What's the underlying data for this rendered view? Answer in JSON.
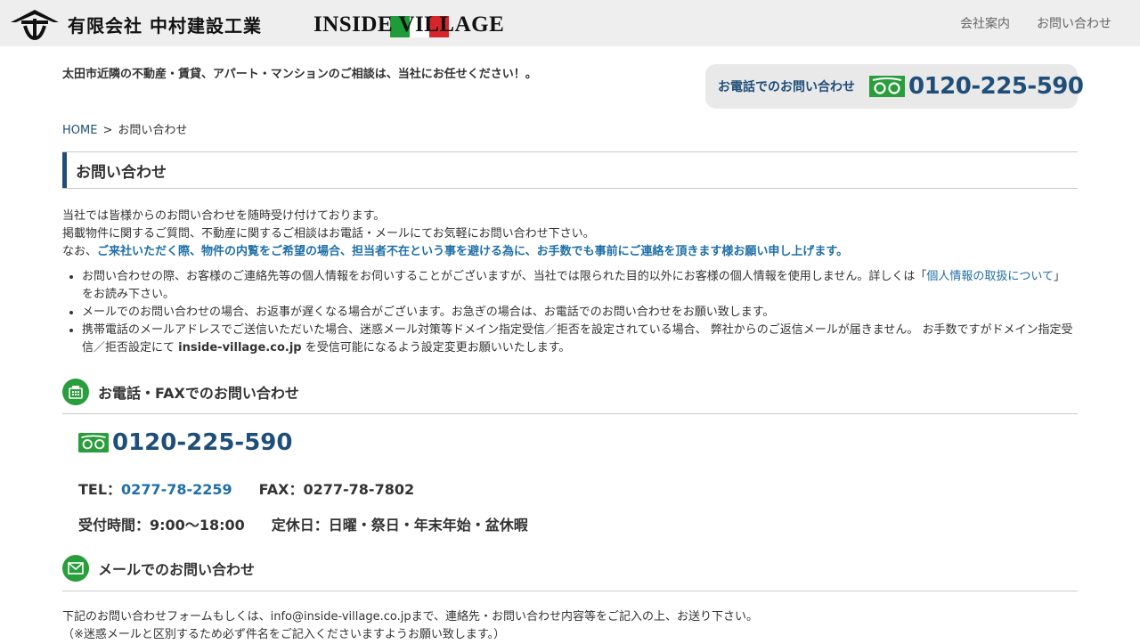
{
  "header": {
    "company_name": "有限会社 中村建設工業",
    "brand_name": "INSIDE VILLAGE",
    "nav": [
      {
        "label": "会社案内"
      },
      {
        "label": "お問い合わせ"
      }
    ],
    "flag_colors": [
      "#1f9c3a",
      "#ffffff",
      "#d7262b"
    ]
  },
  "tagline": "太田市近隣の不動産・賃貸、アパート・マンションのご相談は、当社にお任せください！。",
  "phone_box": {
    "label": "お電話でのお問い合わせ",
    "icon": "free-dial-icon",
    "number": "0120-225-590"
  },
  "breadcrumb": {
    "home": "HOME",
    "separator": ">",
    "current": "お問い合わせ"
  },
  "page_title": "お問い合わせ",
  "intro": {
    "line1": "当社では皆様からのお問い合わせを随時受け付けております。",
    "line2": "掲載物件に関するご質問、不動産に関するご相談はお電話・メールにてお気軽にお問い合わせ下さい。",
    "line3_prefix": "なお、",
    "line3_emphasis": "ご来社いただく際、物件の内覧をご希望の場合、担当者不在という事を避ける為に、お手数でも事前にご連絡を頂きます様お願い申し上げます。"
  },
  "notes": {
    "item1_before": "お問い合わせの際、お客様のご連絡先等の個人情報をお伺いすることがございますが、当社では限られた目的以外にお客様の個人情報を使用しません。詳しくは「",
    "item1_link": "個人情報の取扱について",
    "item1_after": "」をお読み下さい。",
    "item2": "メールでのお問い合わせの場合、お返事が遅くなる場合がございます。お急ぎの場合は、お電話でのお問い合わせをお願い致します。",
    "item3_before": "携帯電話のメールアドレスでご送信いただいた場合、迷惑メール対策等ドメイン指定受信／拒否を設定されている場合、 弊社からのご返信メールが届きません。 お手数ですがドメイン指定受信／拒否設定にて ",
    "item3_domain": "inside-village.co.jp",
    "item3_after": " を受信可能になるよう設定変更お願いいたします。"
  },
  "phone_section": {
    "title": "お電話・FAXでのお問い合わせ",
    "icon": "phone-fax-icon",
    "free_dial": "0120-225-590",
    "tel_label": "TEL：",
    "tel": "0277-78-2259",
    "fax_label": "FAX：",
    "fax": "0277-78-7802",
    "hours_label": "受付時間：",
    "hours": "9:00～18:00",
    "holiday_label": "定休日：",
    "holidays": "日曜・祭日・年末年始・盆休暇"
  },
  "mail_section": {
    "title": "メールでのお問い合わせ",
    "icon": "mail-icon",
    "line1": "下記のお問い合わせフォームもしくは、info@inside-village.co.jpまで、連絡先・お問い合わせ内容等をご記入の上、お送り下さい。",
    "line2": "（※迷惑メールと区別するため必ず件名をご記入くださいますようお願い致します。）"
  }
}
